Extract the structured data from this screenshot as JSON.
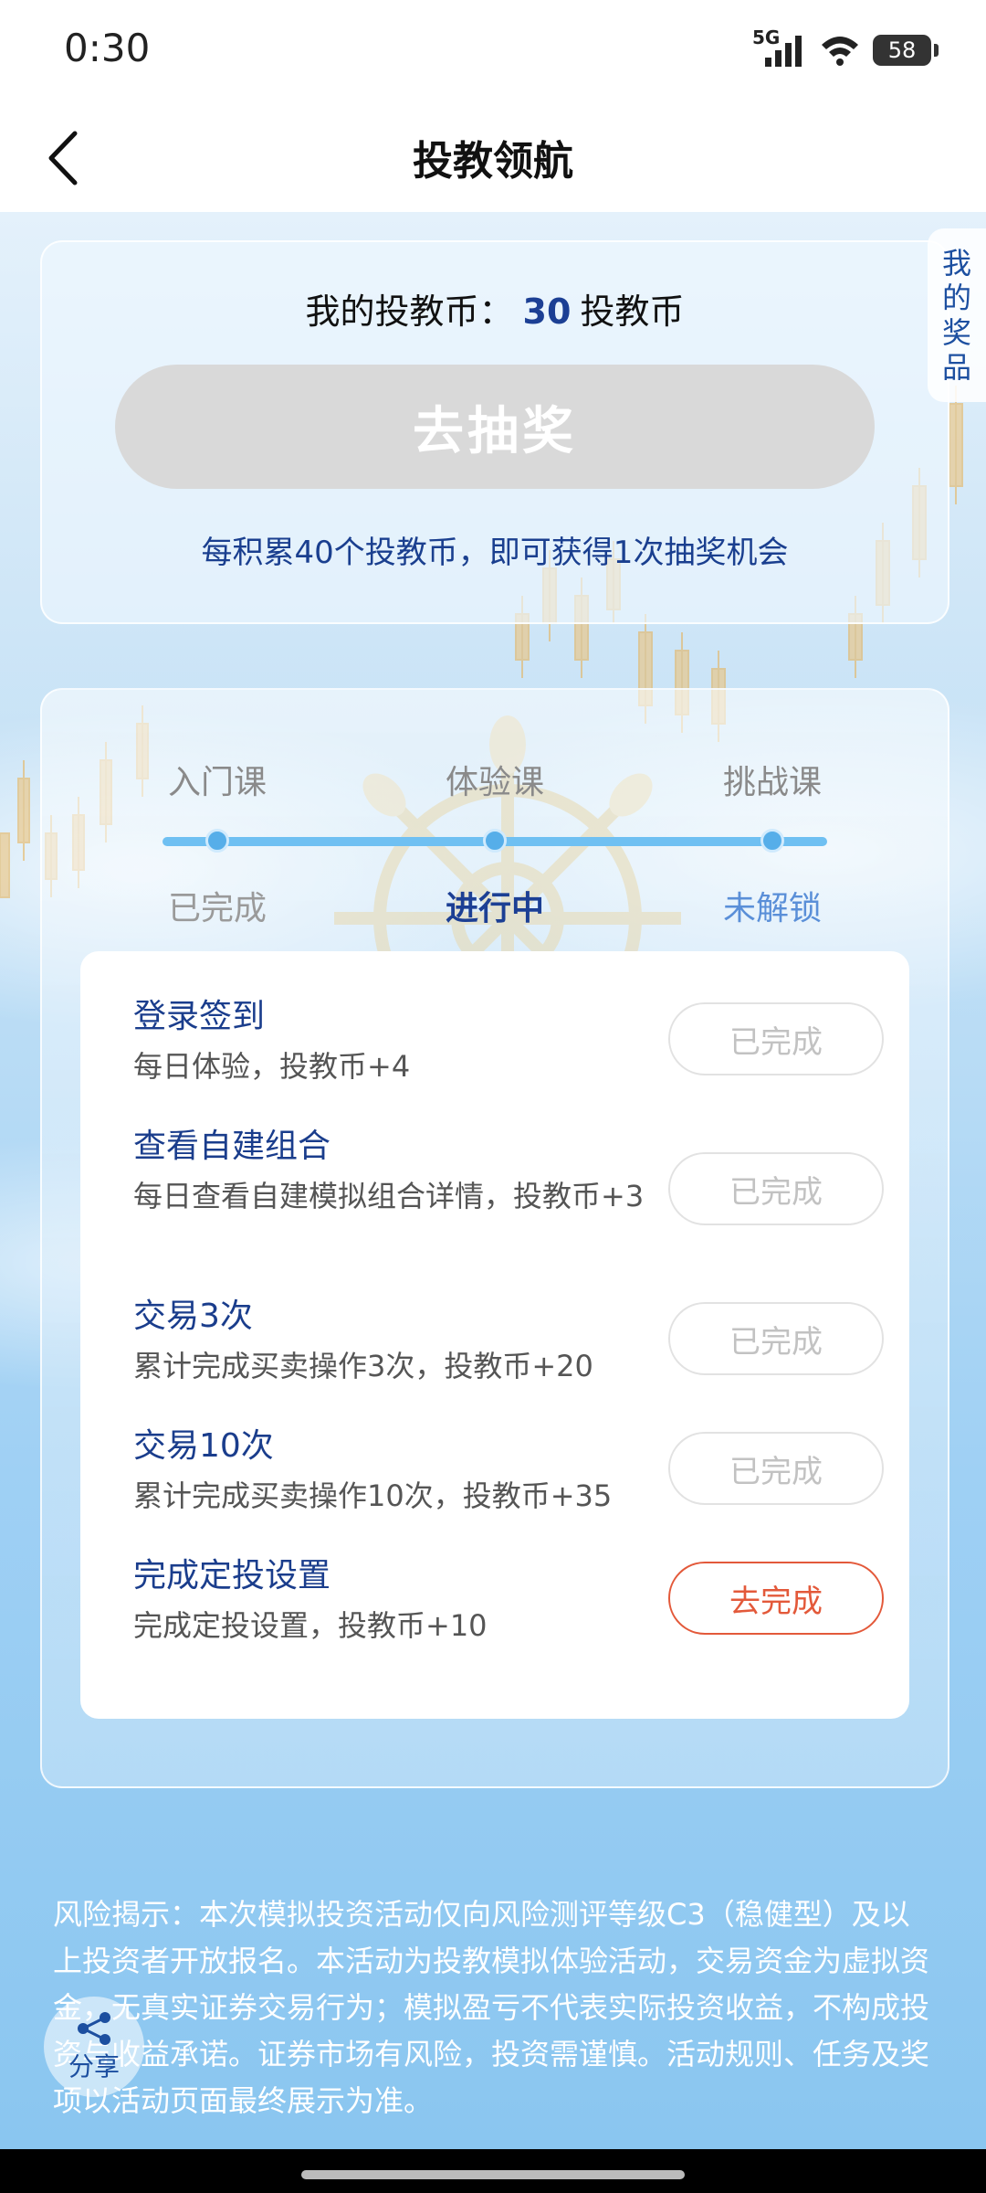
{
  "status": {
    "time": "0:30",
    "network": "5G",
    "battery": "58"
  },
  "nav": {
    "title": "投教领航"
  },
  "coins": {
    "label": "我的投教币：",
    "value": "30",
    "unit": "投教币",
    "draw_button": "去抽奖",
    "tip": "每积累40个投教币，即可获得1次抽奖机会"
  },
  "side": {
    "my_prize": "我的奖品"
  },
  "stages": [
    {
      "name": "入门课",
      "status": "已完成"
    },
    {
      "name": "体验课",
      "status": "进行中"
    },
    {
      "name": "挑战课",
      "status": "未解锁"
    }
  ],
  "stage_colors": {
    "done": "#9a9a9a",
    "active": "#1c3f94",
    "locked": "#5a8fd8"
  },
  "tasks": [
    {
      "title": "登录签到",
      "desc": "每日体验，投教币+4",
      "button": "已完成"
    },
    {
      "title": "查看自建组合",
      "desc": "每日查看自建模拟组合详情，投教币+3",
      "button": "已完成"
    },
    {
      "title": "交易3次",
      "desc": "累计完成买卖操作3次，投教币+20",
      "button": "已完成"
    },
    {
      "title": "交易10次",
      "desc": "累计完成买卖操作10次，投教币+35",
      "button": "已完成"
    },
    {
      "title": "完成定投设置",
      "desc": "完成定投设置，投教币+10",
      "button": "去完成"
    }
  ],
  "risk_text": "风险揭示：本次模拟投资活动仅向风险测评等级C3（稳健型）及以上投资者开放报名。本活动为投教模拟体验活动，交易资金为虚拟资金，无真实证券交易行为；模拟盈亏不代表实际投资收益，不构成投资与收益承诺。证券市场有风险，投资需谨慎。活动规则、任务及奖项以活动页面最终展示为准。",
  "share": {
    "label": "分享"
  }
}
